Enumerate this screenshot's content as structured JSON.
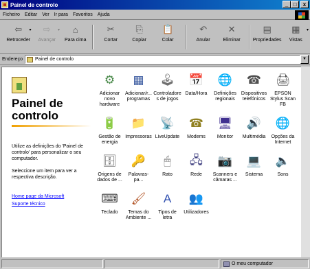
{
  "window": {
    "title": "Painel de controlo",
    "buttons": {
      "minimize": "_",
      "maximize": "□",
      "close": "x"
    }
  },
  "menu": [
    "Ficheiro",
    "Editar",
    "Ver",
    "Ir para",
    "Favoritos",
    "Ajuda"
  ],
  "toolbar": [
    {
      "label": "Retroceder",
      "icon": "back-arrow-icon",
      "glyph": "⇦",
      "disabled": false,
      "dropdown": true
    },
    {
      "label": "Avançar",
      "icon": "forward-arrow-icon",
      "glyph": "⇨",
      "disabled": true,
      "dropdown": true
    },
    {
      "label": "Para cima",
      "icon": "up-folder-icon",
      "glyph": "⌂",
      "disabled": false,
      "dropdown": false
    },
    {
      "label": "Cortar",
      "icon": "cut-icon",
      "glyph": "✂",
      "disabled": false,
      "dropdown": false
    },
    {
      "label": "Copiar",
      "icon": "copy-icon",
      "glyph": "⎘",
      "disabled": false,
      "dropdown": false
    },
    {
      "label": "Colar",
      "icon": "paste-icon",
      "glyph": "📋",
      "disabled": false,
      "dropdown": false
    },
    {
      "label": "Anular",
      "icon": "undo-icon",
      "glyph": "↶",
      "disabled": false,
      "dropdown": false
    },
    {
      "label": "Eliminar",
      "icon": "delete-icon",
      "glyph": "✕",
      "disabled": false,
      "dropdown": false
    },
    {
      "label": "Propriedades",
      "icon": "properties-icon",
      "glyph": "▤",
      "disabled": false,
      "dropdown": false
    },
    {
      "label": "Vistas",
      "icon": "views-icon",
      "glyph": "▦",
      "disabled": false,
      "dropdown": true
    }
  ],
  "address": {
    "label": "Endereço",
    "value": "Painel de controlo"
  },
  "left_panel": {
    "title": "Painel de controlo",
    "description": "Utilize as definições do 'Painel de controlo' para personalizar o seu computador.",
    "hint": "Seleccione um item para ver a respectiva descrição.",
    "links": [
      "Home page da Microsoft",
      "Suporte técnico"
    ]
  },
  "items": [
    {
      "label": "Adicionar novo hardware",
      "icon": "add-hardware-icon",
      "glyph": "⚙",
      "color": "#4a8a4a"
    },
    {
      "label": "Adicionar/r... programas",
      "icon": "add-remove-programs-icon",
      "glyph": "▦",
      "color": "#3a5aa0"
    },
    {
      "label": "Controladores de jogos",
      "icon": "game-controllers-icon",
      "glyph": "🕹",
      "color": "#707070"
    },
    {
      "label": "Data/Hora",
      "icon": "date-time-icon",
      "glyph": "📅",
      "color": "#3050a0"
    },
    {
      "label": "Definições regionais",
      "icon": "globe-icon",
      "glyph": "🌐",
      "color": "#20a040"
    },
    {
      "label": "Dispositivos telefónicos",
      "icon": "telephony-icon",
      "glyph": "☎",
      "color": "#505050"
    },
    {
      "label": "EPSON Stylus Scan FB",
      "icon": "scanner-icon",
      "glyph": "🖨",
      "color": "#505050"
    },
    {
      "label": "Gestão de energia",
      "icon": "power-management-icon",
      "glyph": "🔋",
      "color": "#407040"
    },
    {
      "label": "Impressoras",
      "icon": "printers-folder-icon",
      "glyph": "📁",
      "color": "#c0a020"
    },
    {
      "label": "LiveUpdate",
      "icon": "liveupdate-icon",
      "glyph": "📡",
      "color": "#c0a000"
    },
    {
      "label": "Modems",
      "icon": "modem-icon",
      "glyph": "☎",
      "color": "#908020"
    },
    {
      "label": "Monitor",
      "icon": "monitor-icon",
      "glyph": "🖥",
      "color": "#403090"
    },
    {
      "label": "Multimédia",
      "icon": "multimedia-icon",
      "glyph": "🔊",
      "color": "#505050"
    },
    {
      "label": "Opções da Internet",
      "icon": "internet-options-icon",
      "glyph": "🌐",
      "color": "#2070b0"
    },
    {
      "label": "Origens de dados de ...",
      "icon": "data-sources-icon",
      "glyph": "🗄",
      "color": "#606060"
    },
    {
      "label": "Palavras-pa...",
      "icon": "passwords-key-icon",
      "glyph": "🔑",
      "color": "#c0a020"
    },
    {
      "label": "Rato",
      "icon": "mouse-icon",
      "glyph": "🖱",
      "color": "#707070"
    },
    {
      "label": "Rede",
      "icon": "network-icon",
      "glyph": "🖧",
      "color": "#404080"
    },
    {
      "label": "Scanners e câmaras ...",
      "icon": "scanners-cameras-icon",
      "glyph": "📷",
      "color": "#606060"
    },
    {
      "label": "Sistema",
      "icon": "system-icon",
      "glyph": "💻",
      "color": "#505050"
    },
    {
      "label": "Sons",
      "icon": "sounds-icon",
      "glyph": "🔈",
      "color": "#404060"
    },
    {
      "label": "Teclado",
      "icon": "keyboard-icon",
      "glyph": "⌨",
      "color": "#404040"
    },
    {
      "label": "Temas do Ambiente ...",
      "icon": "desktop-themes-icon",
      "glyph": "🖌",
      "color": "#b05020"
    },
    {
      "label": "Tipos de letra",
      "icon": "fonts-folder-icon",
      "glyph": "A",
      "color": "#3050b0"
    },
    {
      "label": "Utilizadores",
      "icon": "users-icon",
      "glyph": "👥",
      "color": "#404040"
    }
  ],
  "status": {
    "zone": "O meu computador"
  }
}
